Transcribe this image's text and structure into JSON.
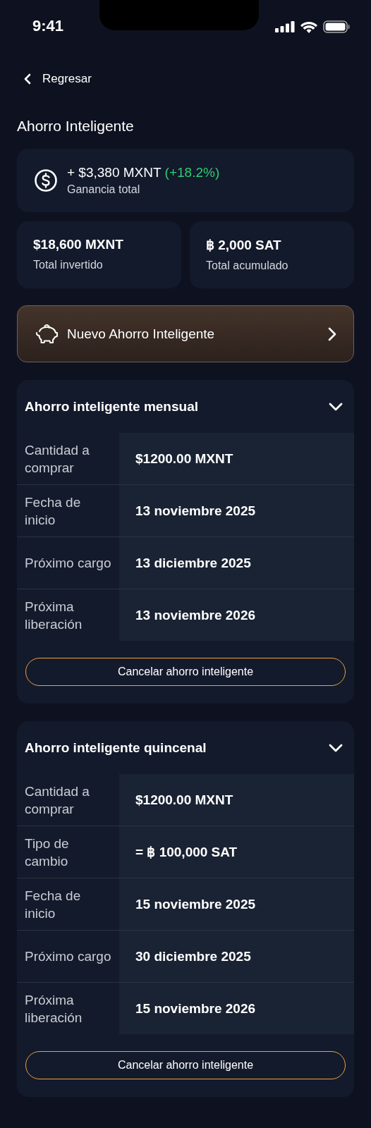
{
  "status_bar": {
    "time": "9:41"
  },
  "back": {
    "label": "Regresar"
  },
  "title": "Ahorro Inteligente",
  "gain": {
    "amount": "+ $3,380 MXNT",
    "change": "(+18.2%)",
    "label": "Ganancia total"
  },
  "totals": [
    {
      "value": "$18,600 MXNT",
      "label": "Total invertido"
    },
    {
      "value": "฿ 2,000 SAT",
      "label": "Total acumulado"
    }
  ],
  "new_button": {
    "label": "Nuevo Ahorro Inteligente"
  },
  "plans": [
    {
      "title": "Ahorro inteligente mensual",
      "rows": [
        {
          "label": "Cantidad a comprar",
          "value": "$1200.00 MXNT"
        },
        {
          "label": "Fecha de inicio",
          "value": "13 noviembre 2025"
        },
        {
          "label": "Próximo cargo",
          "value": "13 diciembre 2025"
        },
        {
          "label": "Próxima liberación",
          "value": "13 noviembre 2026"
        }
      ],
      "cancel": "Cancelar ahorro inteligente"
    },
    {
      "title": "Ahorro inteligente quincenal",
      "rows": [
        {
          "label": "Cantidad a comprar",
          "value": "$1200.00 MXNT"
        },
        {
          "label": "Tipo de cambio",
          "value": "= ฿ 100,000 SAT"
        },
        {
          "label": "Fecha de inicio",
          "value": "15 noviembre 2025"
        },
        {
          "label": "Próximo cargo",
          "value": "30 diciembre 2025"
        },
        {
          "label": "Próxima liberación",
          "value": "15 noviembre 2026"
        }
      ],
      "cancel": "Cancelar ahorro inteligente"
    }
  ]
}
